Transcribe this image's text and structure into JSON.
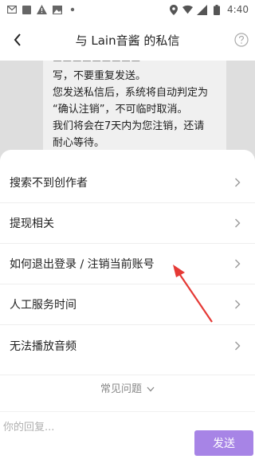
{
  "statusbar": {
    "time": "4:40",
    "icons": [
      "gmail-icon",
      "square-icon",
      "warning-icon",
      "image-icon",
      "dot-icon",
      "location-icon",
      "wifi-icon",
      "cellular-icon",
      "battery-icon"
    ]
  },
  "header": {
    "title": "与 Lain音酱 的私信",
    "back_icon": "back-arrow-icon",
    "help_icon": "help-circle-icon"
  },
  "message": {
    "lines": [
      "写，不要重复发送。",
      "您发送私信后，系统将自动判定为",
      "“确认注销”，不可临时取消。",
      "我们将会在7天内为您注销，还请",
      "耐心等待。"
    ]
  },
  "faq": {
    "items": [
      {
        "label": "搜索不到创作者"
      },
      {
        "label": "提现相关"
      },
      {
        "label": "如何退出登录 / 注销当前账号"
      },
      {
        "label": "人工服务时间"
      },
      {
        "label": "无法播放音频"
      }
    ],
    "footer_label": "常见问题"
  },
  "composer": {
    "placeholder": "你的回复...",
    "send_label": "发送"
  },
  "colors": {
    "accent": "#a784e6",
    "annotation_arrow": "#e53935"
  }
}
